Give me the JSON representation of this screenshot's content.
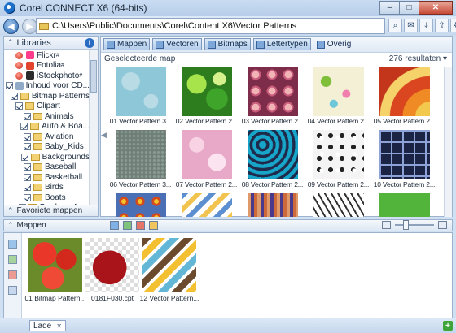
{
  "window": {
    "title": "Corel CONNECT X6 (64-bits)",
    "controls": {
      "minimize": "–",
      "maximize": "□",
      "close": "✕"
    }
  },
  "address": {
    "path": "C:\\Users\\Public\\Documents\\Corel\\Content X6\\Vector Patterns",
    "back_glyph": "◀",
    "forward_glyph": "▶",
    "tool_glyphs": [
      "⌕",
      "✉",
      "⤓",
      "⇪",
      "⚙"
    ]
  },
  "libraries": {
    "title": "Libraries",
    "items": [
      {
        "label": "Flickr",
        "sup": "#",
        "type": "source",
        "icon": "flickr",
        "color": "#ff3d8a"
      },
      {
        "label": "Fotolia",
        "sup": "#",
        "type": "source",
        "icon": "fotolia",
        "color": "#e2442f"
      },
      {
        "label": "iStockphoto",
        "sup": "#",
        "type": "source",
        "icon": "istock",
        "color": "#2b2b2b"
      },
      {
        "label": "Inhoud voor CD...",
        "type": "check",
        "level": 0,
        "checked": true
      },
      {
        "label": "Bitmap Patterns",
        "type": "check",
        "level": 1,
        "checked": true
      },
      {
        "label": "Clipart",
        "type": "check",
        "level": 1,
        "checked": true
      },
      {
        "label": "Animals",
        "type": "check",
        "level": 2,
        "checked": true
      },
      {
        "label": "Auto & Boa...",
        "type": "check",
        "level": 2,
        "checked": true
      },
      {
        "label": "Aviation",
        "type": "check",
        "level": 2,
        "checked": true
      },
      {
        "label": "Baby_Kids",
        "type": "check",
        "level": 2,
        "checked": true
      },
      {
        "label": "Backgrounds",
        "type": "check",
        "level": 2,
        "checked": true
      },
      {
        "label": "Baseball",
        "type": "check",
        "level": 2,
        "checked": true
      },
      {
        "label": "Basketball",
        "type": "check",
        "level": 2,
        "checked": true
      },
      {
        "label": "Birds",
        "type": "check",
        "level": 2,
        "checked": true
      },
      {
        "label": "Boats",
        "type": "check",
        "level": 2,
        "checked": true
      },
      {
        "label": "Borders_An...",
        "type": "check",
        "level": 2,
        "checked": true
      }
    ],
    "favorites_label": "Favoriete mappen"
  },
  "filters": {
    "tabs": [
      "Mappen",
      "Vectoren",
      "Bitmaps",
      "Lettertypen",
      "Overig"
    ]
  },
  "results": {
    "heading": "Geselecteerde map",
    "count": "276 resultaten",
    "items": [
      {
        "label": "01 Vector Pattern 3...",
        "pattern": "p01"
      },
      {
        "label": "02 Vector Pattern 2...",
        "pattern": "p02"
      },
      {
        "label": "03 Vector Pattern 2...",
        "pattern": "p03"
      },
      {
        "label": "04 Vector Pattern 2...",
        "pattern": "p04"
      },
      {
        "label": "05 Vector Pattern 2...",
        "pattern": "p05"
      },
      {
        "label": "06 Vector Pattern 3...",
        "pattern": "p06"
      },
      {
        "label": "07 Vector Pattern 2...",
        "pattern": "p07"
      },
      {
        "label": "08 Vector Pattern 2...",
        "pattern": "p08"
      },
      {
        "label": "09 Vector Pattern 2...",
        "pattern": "p09"
      },
      {
        "label": "10 Vector Pattern 2...",
        "pattern": "p10"
      },
      {
        "label": "",
        "pattern": "p11"
      },
      {
        "label": "",
        "pattern": "p12"
      },
      {
        "label": "",
        "pattern": "p13"
      },
      {
        "label": "",
        "pattern": "p14"
      },
      {
        "label": "",
        "pattern": "p15"
      }
    ]
  },
  "tray": {
    "title": "Mappen",
    "items": [
      {
        "label": "01 Bitmap Pattern...",
        "pattern": "strawberry"
      },
      {
        "label": "0181F030.cpt",
        "pattern": "apple"
      },
      {
        "label": "12 Vector Pattern...",
        "pattern": "chevron"
      }
    ],
    "tab_label": "Lade",
    "tab_close": "✕",
    "add_glyph": "+"
  }
}
